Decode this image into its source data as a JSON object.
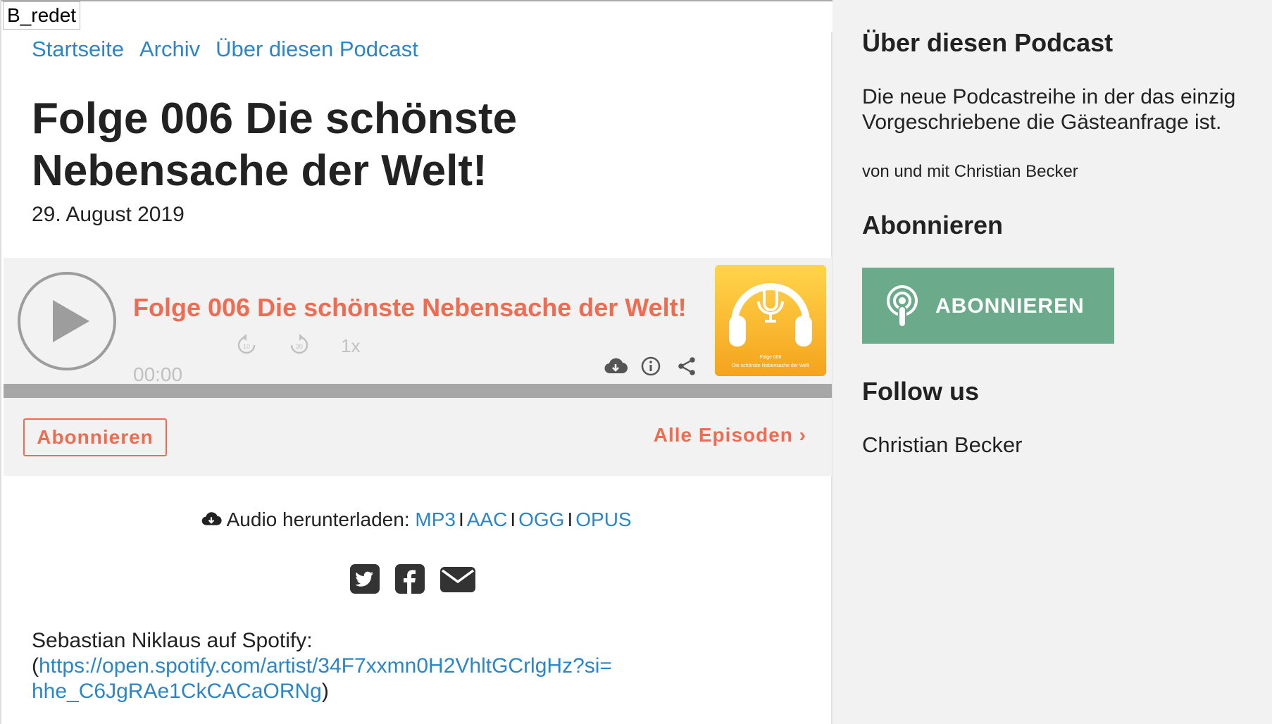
{
  "site": {
    "badge": "B_redet"
  },
  "nav": {
    "items": [
      "Startseite",
      "Archiv",
      "Über diesen Podcast"
    ]
  },
  "episode": {
    "title": "Folge 006 Die schönste Nebensache der Welt!",
    "date": "29. August 2019"
  },
  "player": {
    "title": "Folge 006 Die schönste Nebensache der Welt!",
    "rewind_label": "10",
    "forward_label": "30",
    "speed": "1x",
    "time": "00:00",
    "cover_line1": "Folge 006",
    "cover_line2": "Die schönste Nebensache der Welt",
    "icons": [
      "play-icon",
      "rewind-10-icon",
      "forward-30-icon",
      "download-cloud-icon",
      "info-icon",
      "share-icon"
    ]
  },
  "actions": {
    "subscribe": "Abonnieren",
    "all_episodes": "Alle Episoden ›"
  },
  "download": {
    "label": "Audio herunterladen:",
    "formats": [
      "MP3",
      "AAC",
      "OGG",
      "OPUS"
    ]
  },
  "share": {
    "icons": [
      "twitter-icon",
      "facebook-icon",
      "email-icon"
    ]
  },
  "note": {
    "text": "Sebastian Niklaus auf Spotify:",
    "open_paren": "(",
    "link": "https://open.spotify.com/artist/34F7xxmn0H2VhltGCrlgHz?si=hhe_C6JgRAe1CkCACaORNg",
    "close_paren": ")"
  },
  "sidebar": {
    "about_heading": "Über diesen Podcast",
    "about_text": "Die neue Podcastreihe in der das einzig Vorgeschriebene die Gästeanfrage ist.",
    "author": "von und mit Christian Becker",
    "subscribe_heading": "Abonnieren",
    "subscribe_button": "ABONNIEREN",
    "follow_heading": "Follow us",
    "follow_name": "Christian Becker"
  },
  "colors": {
    "link": "#2a86c6",
    "accent": "#ee6d52",
    "subscribe_green": "#6bab8b",
    "player_bg": "#f2f2f2"
  }
}
